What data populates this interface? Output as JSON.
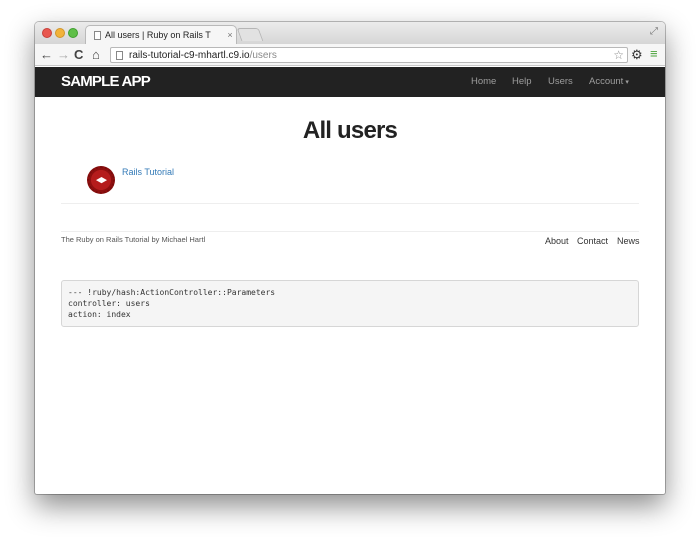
{
  "browser": {
    "tab_title": "All users | Ruby on Rails T",
    "tab_close": "×",
    "url_host": "rails-tutorial-c9-mhartl.c9.io",
    "url_path": "/users",
    "icons": {
      "back": "←",
      "forward": "→",
      "reload": "C",
      "home": "⌂",
      "star": "☆",
      "gear": "⚙",
      "menu": "≡",
      "fullscreen": "⤢"
    }
  },
  "navbar": {
    "logo": "SAMPLE APP",
    "links": {
      "home": "Home",
      "help": "Help",
      "users": "Users",
      "account": "Account"
    },
    "caret": "▾",
    "background": "#222222"
  },
  "main": {
    "title": "All users",
    "users": [
      {
        "name": "Rails Tutorial"
      }
    ],
    "link_color": "#337ab7"
  },
  "footer": {
    "text": "The Ruby on Rails Tutorial by Michael Hartl",
    "links": {
      "about": "About",
      "contact": "Contact",
      "news": "News"
    }
  },
  "debug": {
    "content": "--- !ruby/hash:ActionController::Parameters\ncontroller: users\naction: index"
  }
}
